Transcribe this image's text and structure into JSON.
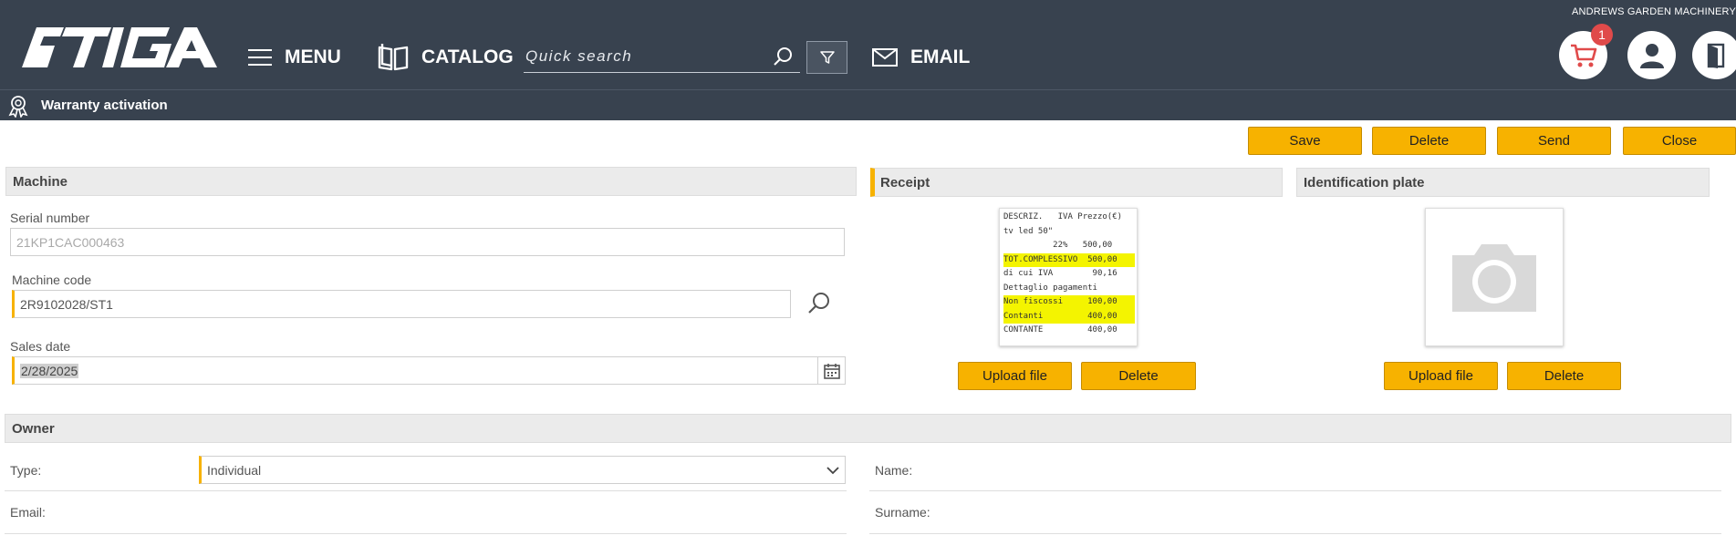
{
  "header": {
    "company": "ANDREWS GARDEN MACHINERY",
    "brand": "STIGA",
    "menu_label": "MENU",
    "catalog_label": "CATALOG",
    "search_placeholder": "Quick search",
    "email_label": "EMAIL",
    "cart_count": "1"
  },
  "subheader": {
    "title": "Warranty activation"
  },
  "actions": {
    "save": "Save",
    "delete": "Delete",
    "send": "Send",
    "close": "Close"
  },
  "machine": {
    "title": "Machine",
    "serial_label": "Serial number",
    "serial_value": "21KP1CAC000463",
    "code_label": "Machine code",
    "code_value": "2R9102028/ST1",
    "date_label": "Sales date",
    "date_value": "2/28/2025"
  },
  "receipt": {
    "title": "Receipt",
    "upload": "Upload file",
    "delete": "Delete",
    "image_lines": [
      {
        "text": "DESCRIZ.   IVA Prezzo(€)",
        "hl": false
      },
      {
        "text": "tv led 50\"",
        "hl": false
      },
      {
        "text": "          22%   500,00",
        "hl": false
      },
      {
        "text": "TOT.COMPLESSIVO  500,00",
        "hl": true
      },
      {
        "text": "di cui IVA        90,16",
        "hl": false
      },
      {
        "text": "Dettaglio pagamenti",
        "hl": false
      },
      {
        "text": "Non fiscossi     100,00",
        "hl": true
      },
      {
        "text": "Contanti         400,00",
        "hl": true
      },
      {
        "text": "CONTANTE         400,00",
        "hl": false
      }
    ]
  },
  "plate": {
    "title": "Identification plate",
    "upload": "Upload file",
    "delete": "Delete"
  },
  "owner": {
    "title": "Owner",
    "type_label": "Type:",
    "type_value": "Individual",
    "name_label": "Name:",
    "email_label": "Email:",
    "surname_label": "Surname:"
  },
  "colors": {
    "header_bg": "#38424f",
    "accent": "#f7b200",
    "badge": "#e04a4a"
  }
}
